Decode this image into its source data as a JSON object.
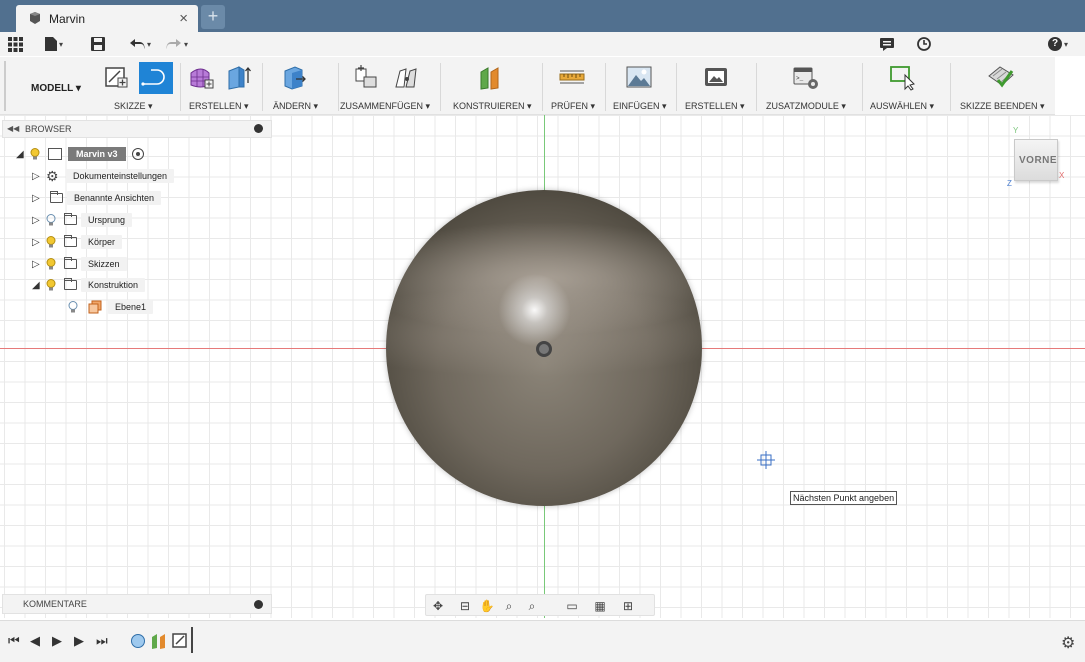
{
  "window": {
    "tab_title": "Marvin",
    "tab_close": "×",
    "new_tab": "+"
  },
  "quick_access": {
    "help": "?"
  },
  "toolbar": {
    "workspace": "MODELL ▾",
    "groups": [
      {
        "label": "SKIZZE ▾"
      },
      {
        "label": "ERSTELLEN ▾"
      },
      {
        "label": "ÄNDERN ▾"
      },
      {
        "label": "ZUSAMMENFÜGEN ▾"
      },
      {
        "label": "KONSTRUIEREN ▾"
      },
      {
        "label": "PRÜFEN ▾"
      },
      {
        "label": "EINFÜGEN ▾"
      },
      {
        "label": "ERSTELLEN ▾"
      },
      {
        "label": "ZUSATZMODULE ▾"
      },
      {
        "label": "AUSWÄHLEN ▾"
      },
      {
        "label": "SKIZZE BEENDEN ▾"
      }
    ]
  },
  "browser": {
    "title": "BROWSER",
    "root": "Marvin v3",
    "items": [
      {
        "label": "Dokumenteinstellungen"
      },
      {
        "label": "Benannte Ansichten"
      },
      {
        "label": "Ursprung"
      },
      {
        "label": "Körper"
      },
      {
        "label": "Skizzen"
      },
      {
        "label": "Konstruktion"
      },
      {
        "label": "Ebene1"
      }
    ]
  },
  "viewport": {
    "viewcube_face": "VORNE",
    "axis_y": "Y",
    "axis_x": "X",
    "axis_z": "Z",
    "tooltip": "Nächsten Punkt angeben"
  },
  "comments": {
    "title": "KOMMENTARE"
  },
  "colors": {
    "titlebar": "#51708f",
    "accent_blue": "#1f84d6",
    "axis_red": "#e67a7a",
    "axis_green": "#79c979"
  }
}
